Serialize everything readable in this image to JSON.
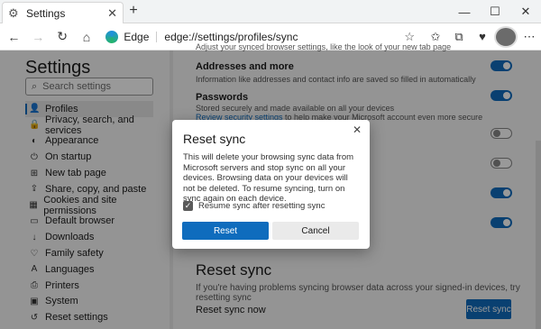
{
  "browser": {
    "tab_title": "Settings",
    "tab_close": "✕",
    "new_tab": "+",
    "site_label": "Edge",
    "url": "edge://settings/profiles/sync"
  },
  "sidebar": {
    "title": "Settings",
    "search_placeholder": "Search settings",
    "items": [
      {
        "label": "Profiles",
        "icon": "person-icon"
      },
      {
        "label": "Privacy, search, and services",
        "icon": "lock-icon"
      },
      {
        "label": "Appearance",
        "icon": "appearance-icon"
      },
      {
        "label": "On startup",
        "icon": "power-icon"
      },
      {
        "label": "New tab page",
        "icon": "new-tab-icon"
      },
      {
        "label": "Share, copy, and paste",
        "icon": "share-icon"
      },
      {
        "label": "Cookies and site permissions",
        "icon": "cookies-icon"
      },
      {
        "label": "Default browser",
        "icon": "browser-icon"
      },
      {
        "label": "Downloads",
        "icon": "download-icon"
      },
      {
        "label": "Family safety",
        "icon": "family-icon"
      },
      {
        "label": "Languages",
        "icon": "languages-icon"
      },
      {
        "label": "Printers",
        "icon": "printer-icon"
      },
      {
        "label": "System",
        "icon": "system-icon"
      },
      {
        "label": "Reset settings",
        "icon": "reset-icon"
      }
    ]
  },
  "main": {
    "top_desc": "Adjust your synced browser settings, like the look of your new tab page",
    "addresses_title": "Addresses and more",
    "addresses_desc": "Information like addresses and contact info are saved so filled in automatically",
    "passwords_title": "Passwords",
    "passwords_desc": "Stored securely and made available on all your devices",
    "passwords_link": "Review security settings",
    "passwords_link_rest": " to help make your Microsoft account even more secure",
    "reset_title": "Reset sync",
    "reset_desc": "If you're having problems syncing browser data across your signed-in devices, try resetting sync",
    "reset_row_label": "Reset sync now",
    "reset_button": "Reset sync"
  },
  "dialog": {
    "title": "Reset sync",
    "body": "This will delete your browsing sync data from Microsoft servers and stop sync on all your devices. Browsing data on your devices will not be deleted. To resume syncing, turn on sync again on each device.",
    "checkbox_label": "Resume sync after resetting sync",
    "checkbox_checked": true,
    "primary_button": "Reset",
    "secondary_button": "Cancel"
  },
  "colors": {
    "accent": "#0f6cbd",
    "overlay": "rgba(0,0,0,0.40)"
  }
}
